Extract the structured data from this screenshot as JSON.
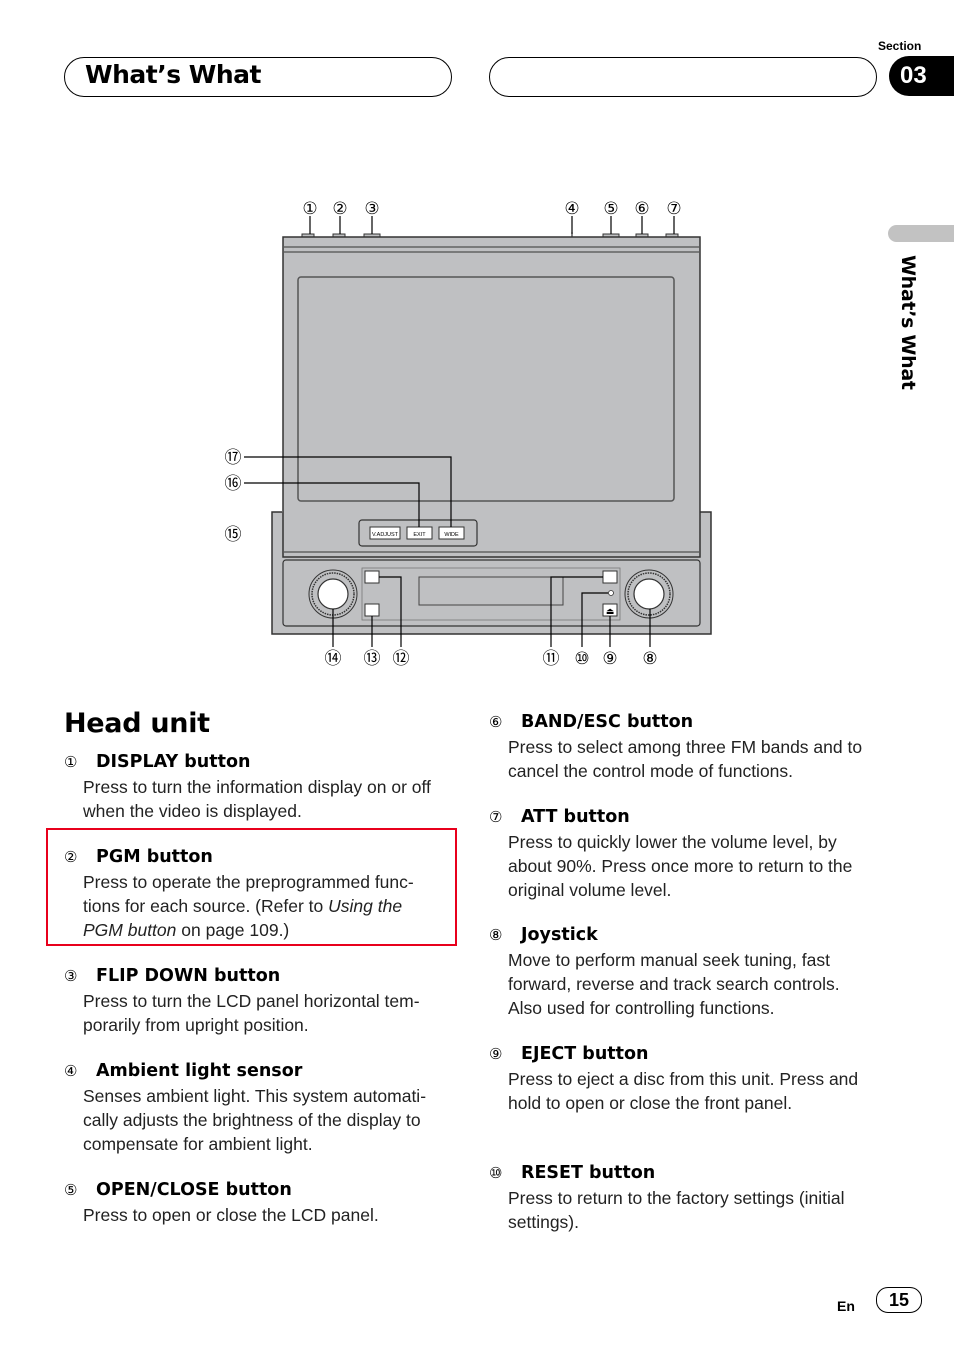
{
  "header": {
    "title": "What’s What",
    "section_label": "Section",
    "section_number": "03",
    "side_tab_label": "What’s What"
  },
  "diagram": {
    "callouts_top": [
      "①",
      "②",
      "③",
      "④",
      "⑤",
      "⑥",
      "⑦"
    ],
    "callouts_left": [
      "⑰",
      "⑯",
      "⑮"
    ],
    "callouts_bottom": [
      "⑭",
      "⑬",
      "⑫",
      "⑪",
      "⑩",
      "⑨",
      "⑧"
    ],
    "screen_buttons": [
      "V.ADJUST",
      "EXIT",
      "WIDE"
    ],
    "eject_symbol": "⏏"
  },
  "content": {
    "heading": "Head unit",
    "items": [
      {
        "num": "①",
        "title": "DISPLAY button",
        "desc": "Press to turn the information display on or off when the video is displayed."
      },
      {
        "num": "②",
        "title": "PGM button",
        "desc_pre": "Press to operate the preprogrammed func-tions for each source. (Refer to ",
        "desc_italic": "Using the PGM button",
        "desc_post": " on page 109.)"
      },
      {
        "num": "③",
        "title": "FLIP DOWN button",
        "desc": "Press to turn the LCD panel horizontal tem-porarily from upright position."
      },
      {
        "num": "④",
        "title": "Ambient light sensor",
        "desc": "Senses ambient light. This system automati-cally adjusts the brightness of the display to compensate for ambient light."
      },
      {
        "num": "⑤",
        "title": "OPEN/CLOSE button",
        "desc": "Press to open or close the LCD panel."
      },
      {
        "num": "⑥",
        "title": "BAND/ESC button",
        "desc": "Press to select among three FM bands and to cancel the control mode of functions."
      },
      {
        "num": "⑦",
        "title": "ATT button",
        "desc": "Press to quickly lower the volume level, by about 90%. Press once more to return to the original volume level."
      },
      {
        "num": "⑧",
        "title": "Joystick",
        "desc": "Move to perform manual seek tuning, fast forward, reverse and track search controls. Also used for controlling functions."
      },
      {
        "num": "⑨",
        "title": "EJECT button",
        "desc": "Press to eject a disc from this unit. Press and hold to open or close the front panel."
      },
      {
        "num": "⑩",
        "title": "RESET button",
        "desc": "Press to return to the factory settings (initial settings)."
      }
    ]
  },
  "footer": {
    "language": "En",
    "page_number": "15"
  },
  "colors": {
    "highlight": "#e8001c",
    "device_gray": "#bfc0c2"
  }
}
